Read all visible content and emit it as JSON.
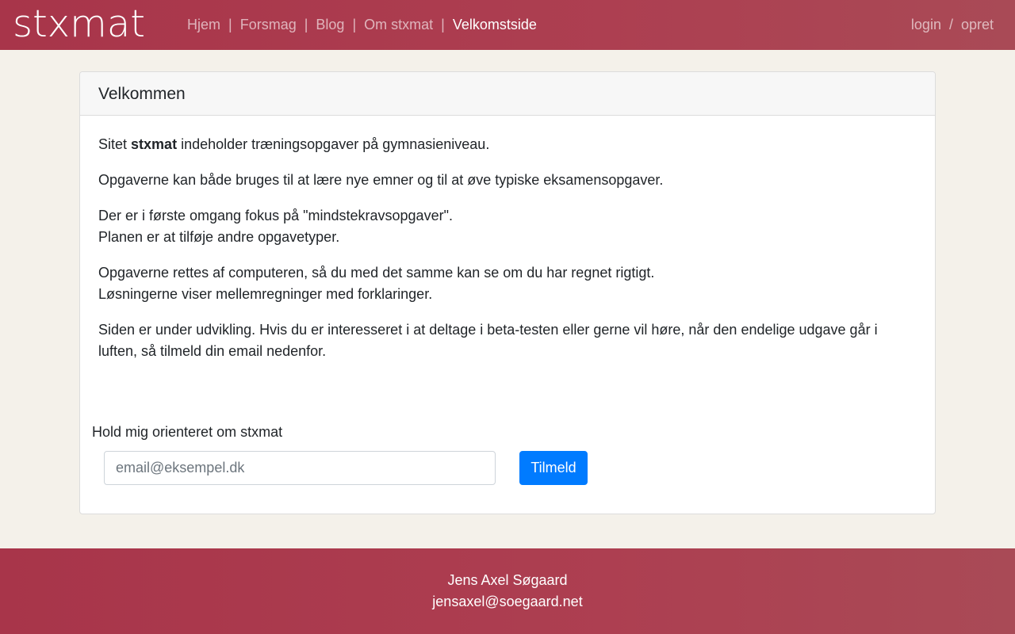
{
  "navbar": {
    "logo": "stxmat",
    "links": [
      "Hjem",
      "Forsmag",
      "Blog",
      "Om stxmat",
      "Velkomstside"
    ],
    "separator": "|",
    "auth_login": "login",
    "auth_separator": "/",
    "auth_register": "opret"
  },
  "card": {
    "title": "Velkommen",
    "p1_pre": "Sitet ",
    "p1_bold": "stxmat",
    "p1_post": " indeholder træningsopgaver på gymnasieniveau.",
    "p2": "Opgaverne kan både bruges til at lære nye emner og til at øve typiske eksamensopgaver.",
    "p3_line1": "Der er i første omgang fokus på \"mindstekravsopgaver\".",
    "p3_line2": "Planen er at tilføje andre opgavetyper.",
    "p4_line1": "Opgaverne rettes af computeren, så du med det samme kan se om du har regnet rigtigt.",
    "p4_line2": "Løsningerne viser mellemregninger med forklaringer.",
    "p5": "Siden er under udvikling. Hvis du er interesseret i at deltage i beta-testen eller gerne vil høre, når den endelige udgave går i luften, så tilmeld din email nedenfor."
  },
  "signup": {
    "label": "Hold mig orienteret om stxmat",
    "placeholder": "email@eksempel.dk",
    "button": "Tilmeld"
  },
  "footer": {
    "name": "Jens Axel Søgaard",
    "email": "jensaxel@soegaard.net"
  },
  "colors": {
    "brand": "#ad3f51",
    "primary_button": "#007bff",
    "background": "#f4f1ea"
  }
}
